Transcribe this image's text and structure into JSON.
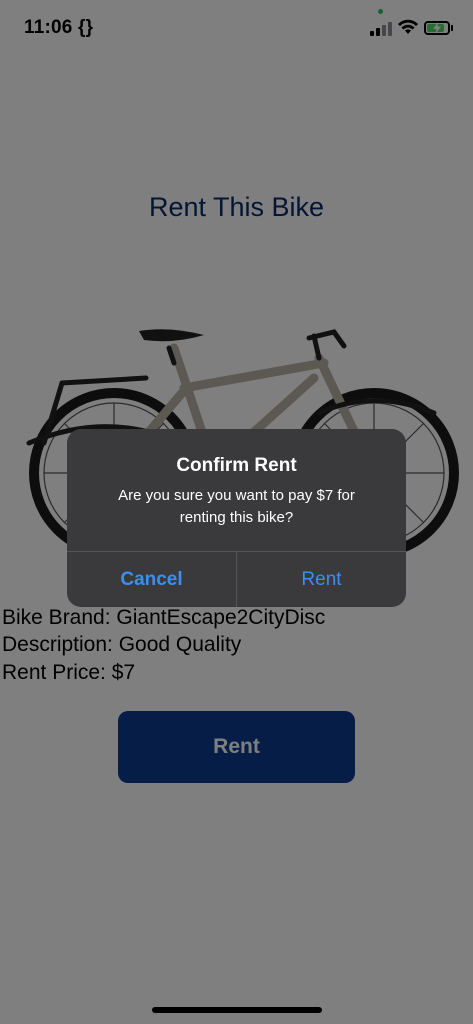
{
  "status_bar": {
    "time": "11:06 {}",
    "icons": [
      "signal-icon",
      "wifi-icon",
      "battery-charging-icon"
    ],
    "accent_green": "#32c759"
  },
  "page": {
    "title": "Rent This Bike",
    "bike_image": "bicycle-photo",
    "brand_line": "Bike Brand: GiantEscape2CityDisc",
    "description_line": "Description: Good Quality",
    "price_line": "Rent Price: $7",
    "rent_button": "Rent",
    "button_color": "#0a3a8f",
    "title_color": "#0a2a6b"
  },
  "alert": {
    "title": "Confirm Rent",
    "message": "Are you sure you want to pay $7 for renting this bike?",
    "cancel_label": "Cancel",
    "confirm_label": "Rent",
    "action_color": "#3b8ff0"
  }
}
